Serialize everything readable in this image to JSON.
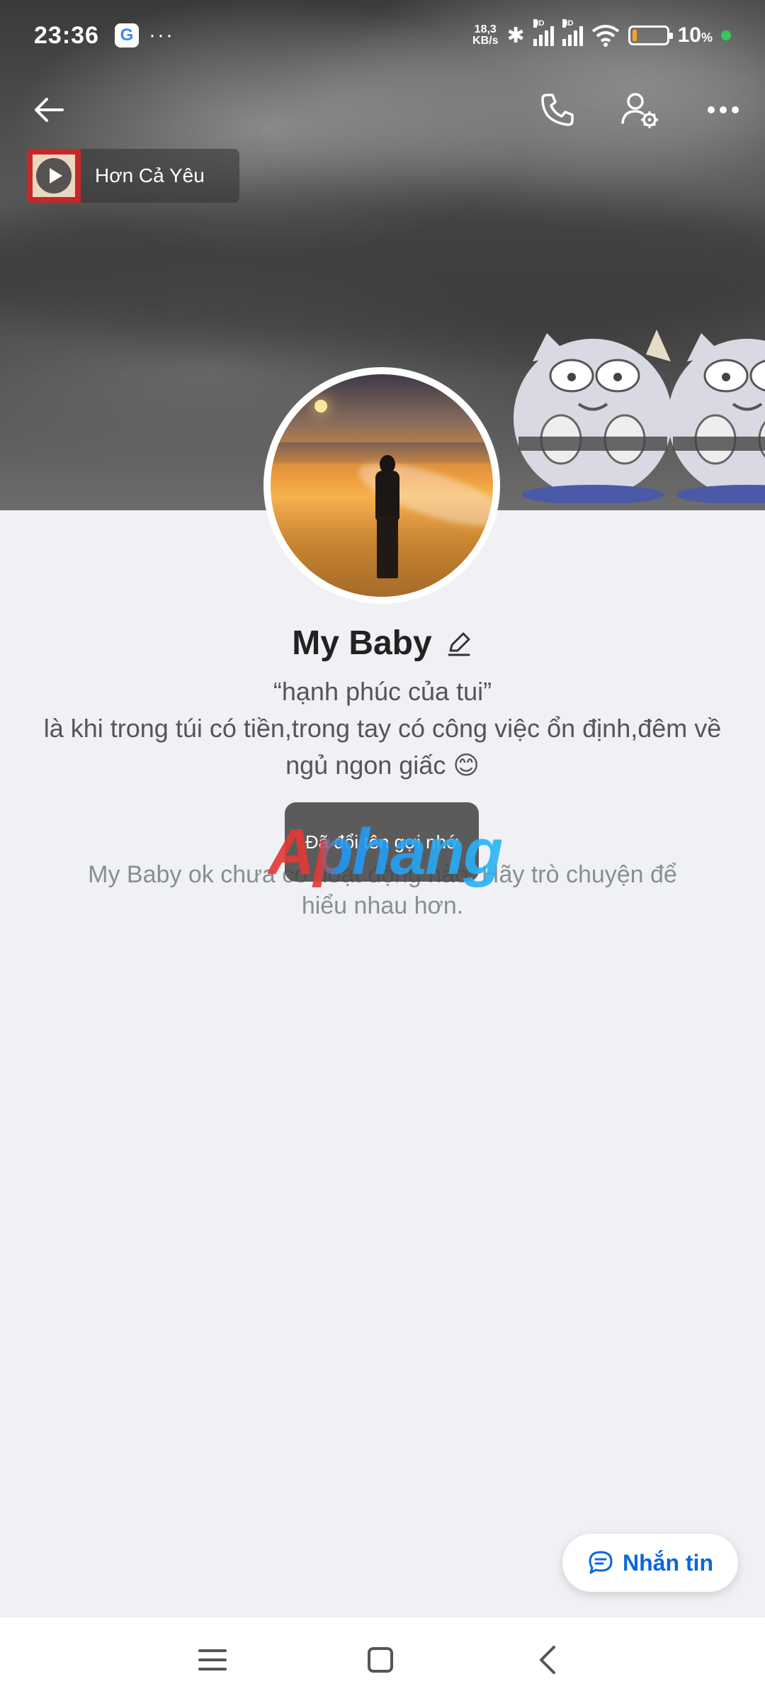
{
  "status_bar": {
    "time": "23:36",
    "google_badge": "G",
    "overflow": "···",
    "net_speed_value": "18,3",
    "net_speed_unit": "KB/s",
    "signal_label": "HD",
    "battery_percent": "10",
    "battery_unit": "%"
  },
  "profile": {
    "music_title": "Hơn Cả Yêu",
    "name": "My Baby",
    "bio_line1": "“hạnh phúc của tui”",
    "bio_line2": "là khi trong túi có tiền,trong tay có công việc ổn định,đêm về ngủ ngon giấc 😊",
    "empty_note": "My Baby ok chưa có hoạt động nào. Hãy trò chuyện để hiểu nhau hơn."
  },
  "toast": {
    "text": "Đã đổi tên gợi nhớ"
  },
  "watermark": {
    "text": "Aphang"
  },
  "actions": {
    "message_label": "Nhắn tin"
  },
  "icons": {
    "back": "arrow-left-icon",
    "call": "phone-icon",
    "settings": "user-settings-icon",
    "more": "more-horizontal-icon",
    "edit": "pencil-icon",
    "chat": "chat-bubble-icon",
    "play": "play-icon"
  },
  "colors": {
    "accent": "#0a68d8",
    "background": "#f0f1f5",
    "toast_bg": "#464646"
  }
}
